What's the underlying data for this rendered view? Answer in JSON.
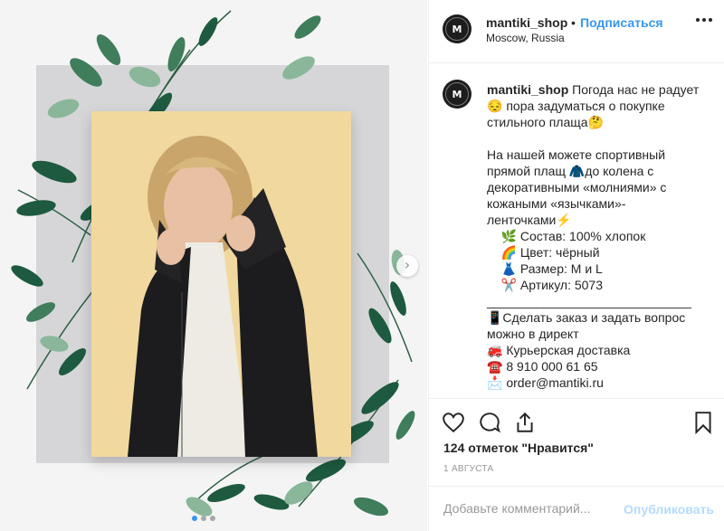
{
  "post": {
    "avatar_letter": "M",
    "username": "mantiki_shop",
    "separator": "•",
    "follow_label": "Подписаться",
    "location": "Moscow, Russia",
    "caption_text": " Погода нас не радует\n😔 пора задуматься о покупке стильного плаща🤔\n\nНа нашей можете спортивный прямой плащ 🧥до колена с декоративными «молниями» с кожаными «язычками»-ленточками⚡\n    🌿 Состав: 100% хлопок\n    🌈 Цвет: чёрный\n    👗 Размер: M и L\n    ✂️ Артикул: 5073\n_____________________________\n📱Сделать заказ и задать вопрос можно в директ\n🚒 Курьерская доставка\n☎️ 8 910 000 61 65\n📩 order@mantiki.ru",
    "likes_text": "124 отметок \"Нравится\"",
    "date": "1 АВГУСТА",
    "comment_placeholder": "Добавьте комментарий...",
    "publish_label": "Опубликовать"
  },
  "carousel": {
    "next_glyph": "›",
    "active_index": 0,
    "count": 3
  },
  "colors": {
    "accent": "#3897f0",
    "publish_disabled": "#b3dbff",
    "backdrop": "#f1d89e",
    "leaf_dark": "#1d5a3f",
    "leaf_mid": "#3f7d5b",
    "leaf_light": "#8ab79a"
  },
  "icons": {
    "like": "heart-icon",
    "comment": "comment-icon",
    "share": "share-icon",
    "save": "bookmark-icon",
    "more": "more-dots-icon",
    "next": "chevron-right-icon",
    "cursor": "mouse-cursor-icon"
  }
}
